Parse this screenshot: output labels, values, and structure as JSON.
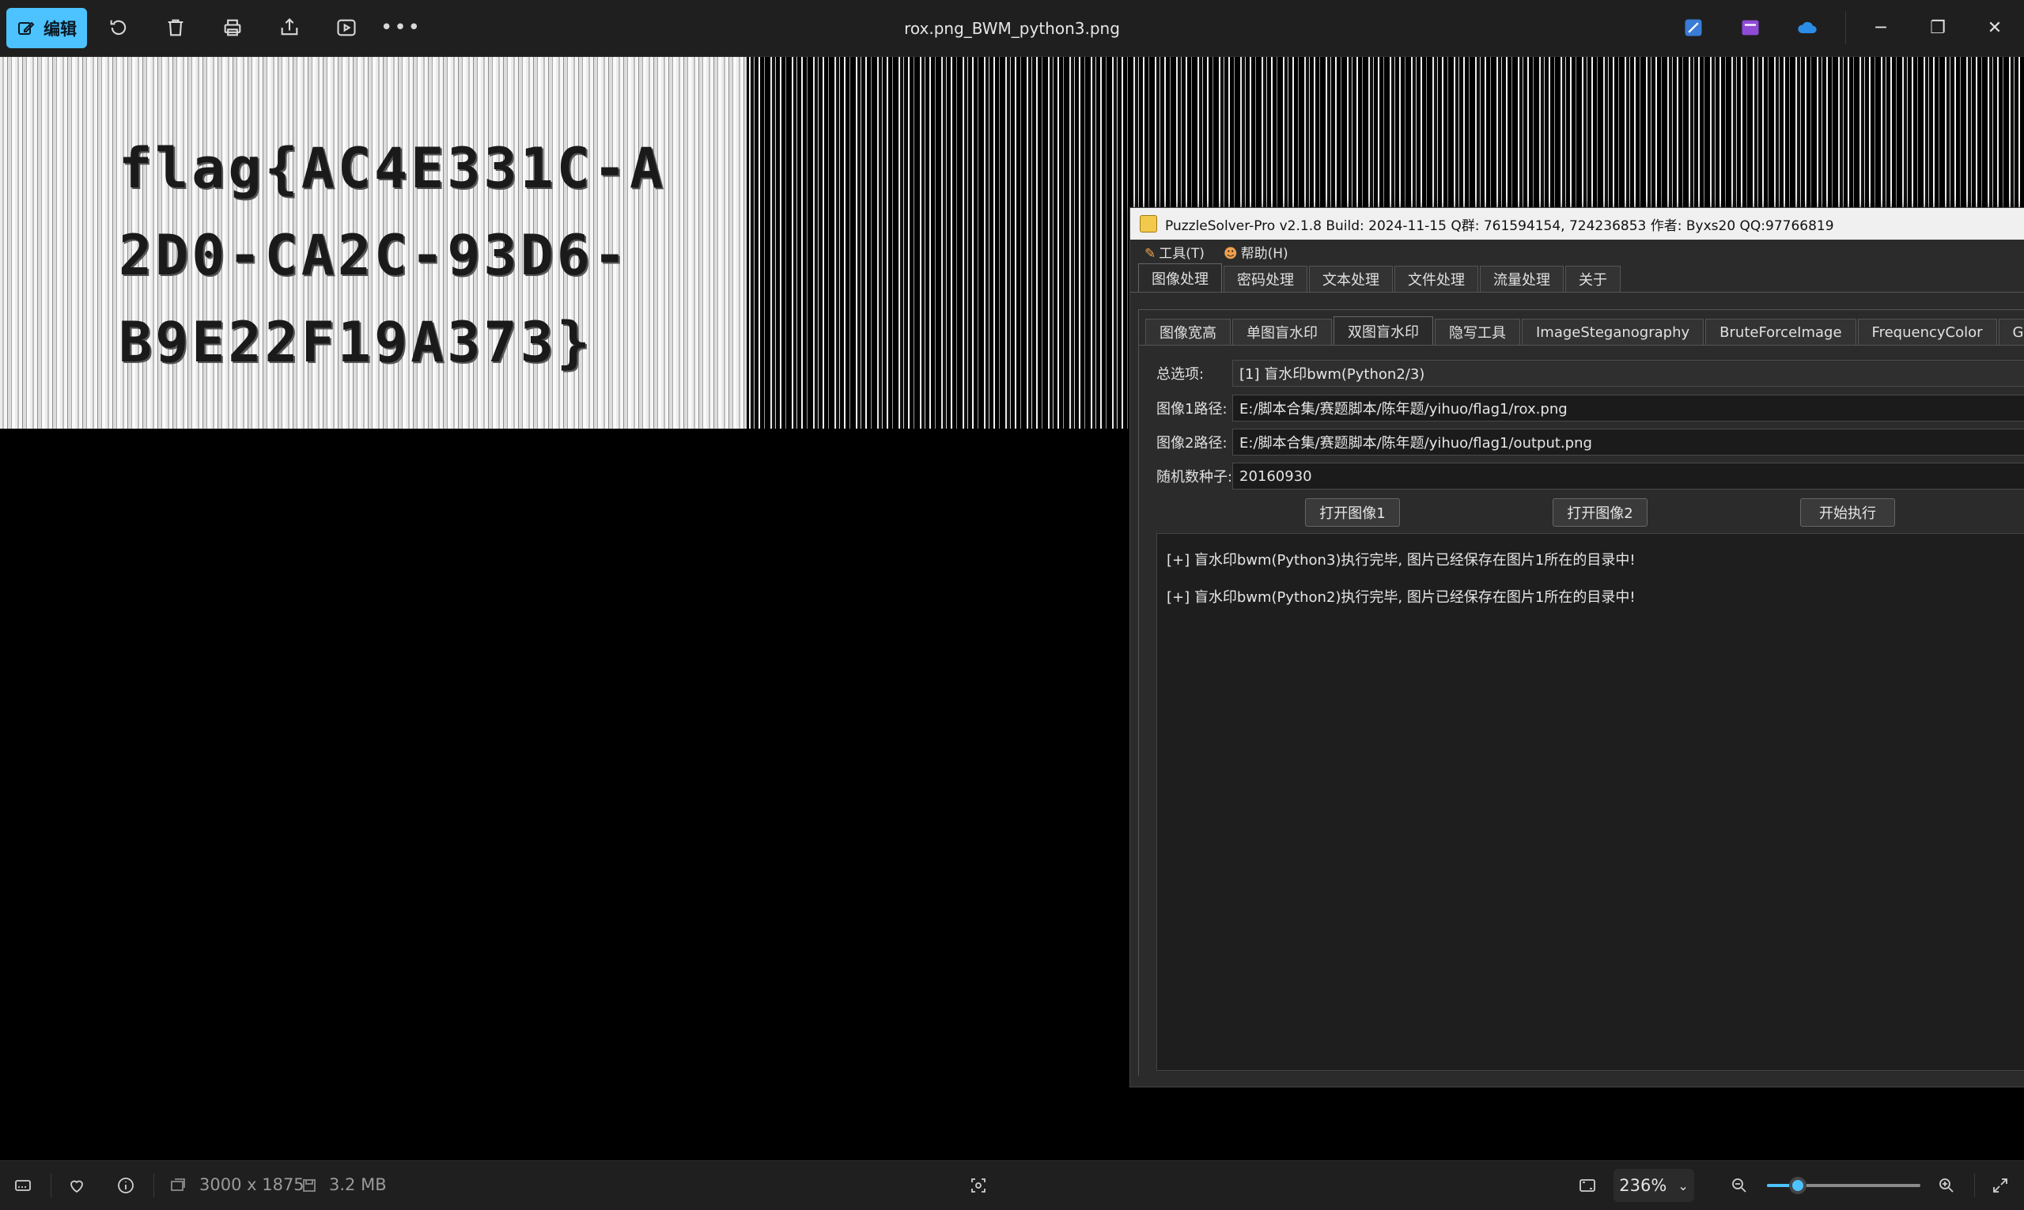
{
  "toolbar": {
    "edit_label": "编辑",
    "file_title": "rox.png_BWM_python3.png"
  },
  "image": {
    "lines": [
      "flag{AC4E331C-A",
      "2D0-CA2C-93D6-",
      "B9E22F19A373}"
    ]
  },
  "puzzle_solver": {
    "title": "PuzzleSolver-Pro v2.1.8  Build: 2024-11-15  Q群: 761594154, 724236853  作者: Byxs20  QQ:97766819",
    "menu": [
      "工具(T)",
      "帮助(H)"
    ],
    "tabs": [
      "图像处理",
      "密码处理",
      "文本处理",
      "文件处理",
      "流量处理",
      "关于"
    ],
    "subtabs": [
      "图像宽高",
      "单图盲水印",
      "双图盲水印",
      "隐写工具",
      "ImageSteganography",
      "BruteForceImage",
      "FrequencyColor",
      "GIF"
    ],
    "form": {
      "option_label": "总选项:",
      "option_value": "[1] 盲水印bwm(Python2/3)",
      "image1_label": "图像1路径:",
      "image1_value": "E:/脚本合集/赛题脚本/陈年题/yihuo/flag1/rox.png",
      "image2_label": "图像2路径:",
      "image2_value": "E:/脚本合集/赛题脚本/陈年题/yihuo/flag1/output.png",
      "seed_label": "随机数种子:",
      "seed_value": "20160930"
    },
    "buttons": {
      "open1": "打开图像1",
      "open2": "打开图像2",
      "run": "开始执行"
    },
    "log": [
      "[+] 盲水印bwm(Python3)执行完毕, 图片已经保存在图片1所在的目录中!",
      "[+] 盲水印bwm(Python2)执行完毕, 图片已经保存在图片1所在的目录中!"
    ]
  },
  "statusbar": {
    "dimensions": "3000 x 1875",
    "file_size": "3.2 MB",
    "zoom": "236%",
    "zoom_slider_fraction": 0.2
  },
  "colors": {
    "accent": "#4cc2ff",
    "toolbar_bg": "#1f1f1f"
  }
}
